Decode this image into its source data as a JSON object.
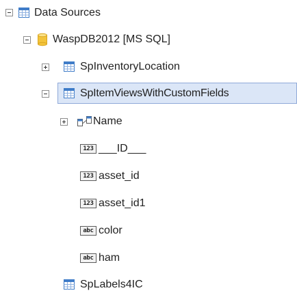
{
  "tree": {
    "root": {
      "label": "Data Sources",
      "icon": "table-icon",
      "expanded": true
    },
    "connection": {
      "label": "WaspDB2012 [MS SQL]",
      "icon": "database-icon",
      "expanded": true
    },
    "tables": [
      {
        "label": "SpInventoryLocation",
        "icon": "table-icon",
        "expanded": false
      },
      {
        "label": "SpItemViewsWithCustomFields",
        "icon": "table-icon",
        "expanded": true,
        "selected": true
      },
      {
        "label": "SpLabels4IC",
        "icon": "table-icon"
      }
    ],
    "fields": [
      {
        "label": "Name",
        "icon": "relation-icon",
        "expanded": false
      },
      {
        "label": "___ID___",
        "icon": "numeric-field-icon",
        "badge": "123"
      },
      {
        "label": "asset_id",
        "icon": "numeric-field-icon",
        "badge": "123"
      },
      {
        "label": "asset_id1",
        "icon": "numeric-field-icon",
        "badge": "123"
      },
      {
        "label": "color",
        "icon": "text-field-icon",
        "badge": "abc"
      },
      {
        "label": "ham",
        "icon": "text-field-icon",
        "badge": "abc"
      }
    ]
  },
  "colors": {
    "selection_bg": "#dbe6f7",
    "selection_border": "#8fa9d8",
    "db_icon": "#f3c43b",
    "table_icon": "#3f7cc8"
  }
}
